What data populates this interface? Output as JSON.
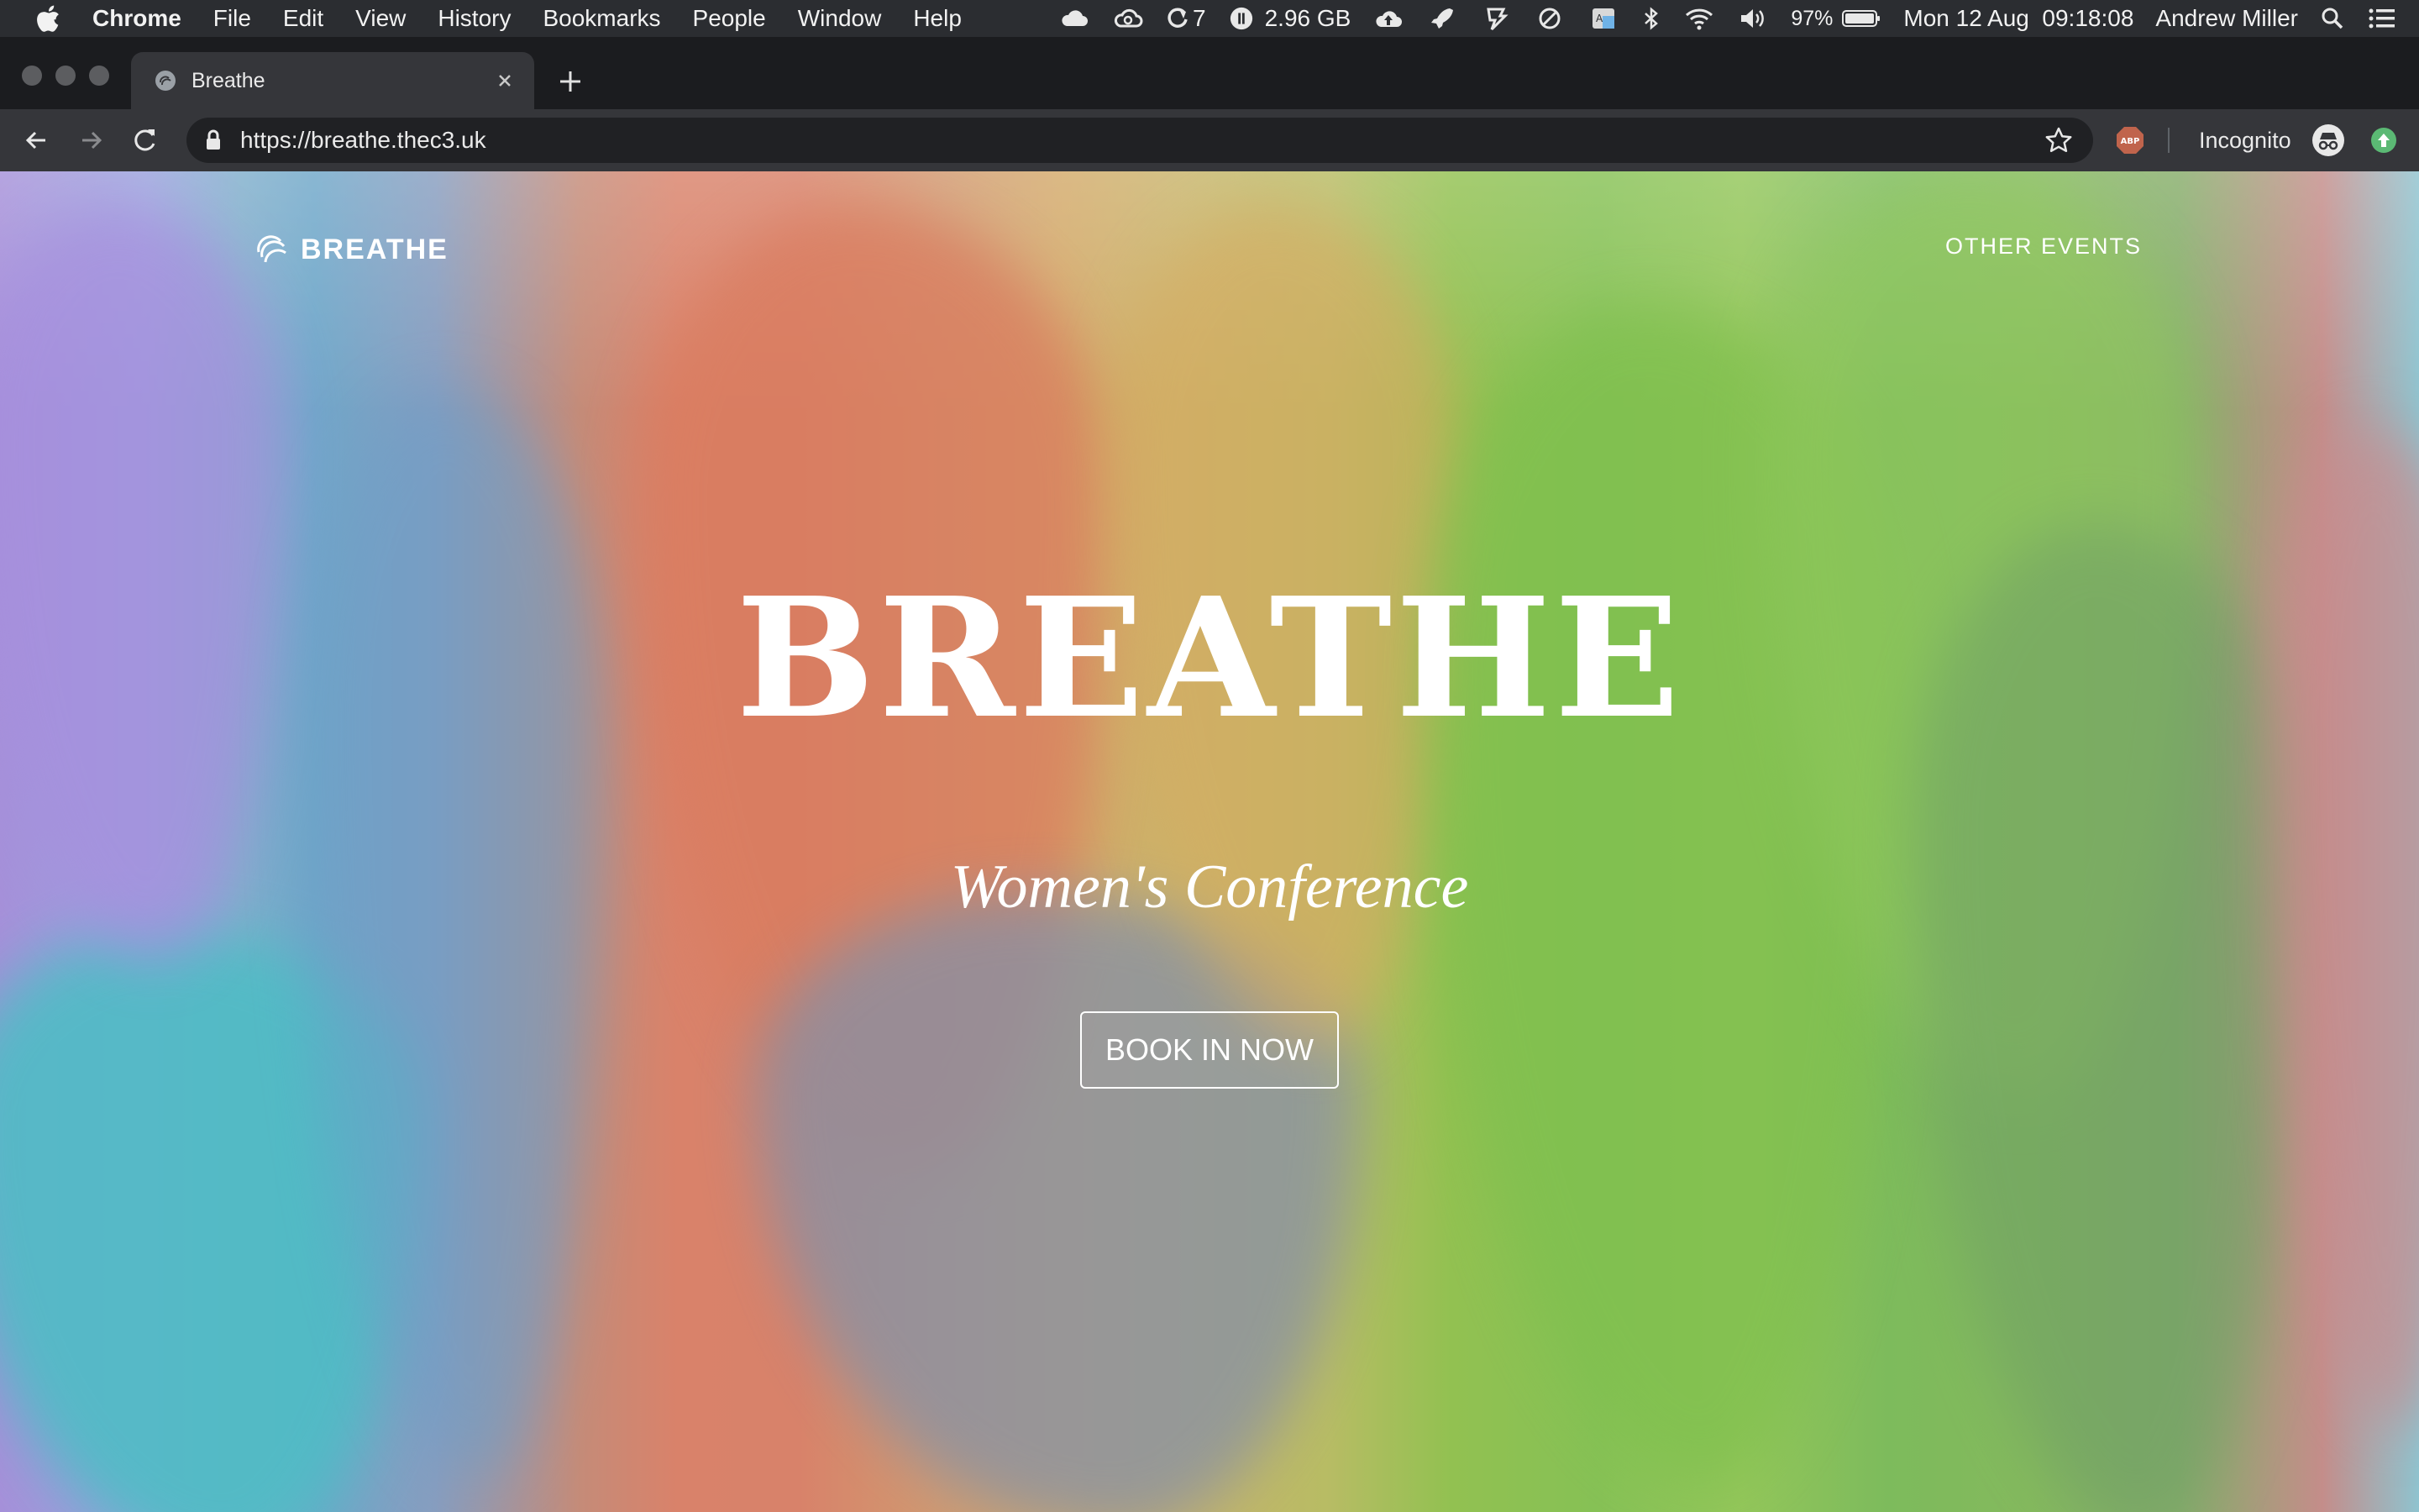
{
  "menubar": {
    "app": "Chrome",
    "items": [
      "File",
      "Edit",
      "View",
      "History",
      "Bookmarks",
      "People",
      "Window",
      "Help"
    ],
    "status": {
      "notification_count": "7",
      "memory": "2.96 GB",
      "battery": "97%",
      "datetime": "Mon 12 Aug  09:18:08",
      "user": "Andrew Miller"
    }
  },
  "browser": {
    "tab_title": "Breathe",
    "url": "https://breathe.thec3.uk",
    "profile_label": "Incognito",
    "abp_label": "ABP"
  },
  "site": {
    "logo_text": "BREATHE",
    "nav_other": "OTHER EVENTS",
    "hero_title": "BREATHE",
    "hero_subtitle": "Women's Conference",
    "cta": "BOOK IN NOW"
  }
}
